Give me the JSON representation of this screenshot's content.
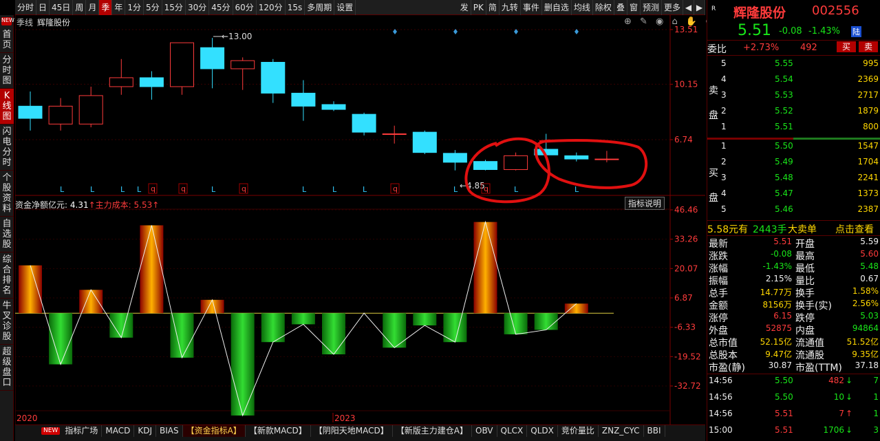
{
  "toolbar": {
    "items": [
      "分时",
      "日",
      "45日",
      "周",
      "月",
      "季",
      "年",
      "1分",
      "5分",
      "15分",
      "30分",
      "45分",
      "60分",
      "120分",
      "15s",
      "多周期",
      "设置"
    ],
    "active_index": 5,
    "right_items": [
      "发",
      "PK",
      "简",
      "九转",
      "事件",
      "删自选",
      "均线",
      "除权",
      "叠",
      "窗",
      "预测",
      "更多"
    ]
  },
  "leftnav": {
    "items": [
      "首页",
      "分时图",
      "K线图",
      "闪电分时",
      "个股资料",
      "自选股",
      "综合排名",
      "牛叉诊股",
      "超级盘口"
    ],
    "active_index": 2,
    "new_badge": "NEW"
  },
  "main_chart": {
    "period_label": "季线",
    "stock_name": "辉隆股份",
    "price_axis": [
      "13.51",
      "10.15",
      "6.74"
    ],
    "high_tag": "13.00",
    "low_tag": "4.85",
    "signals": [
      "L",
      "L",
      "L",
      "L",
      "q",
      "q",
      "L",
      "q",
      "L",
      "L",
      "L",
      "q",
      "L",
      "q",
      "L",
      "L"
    ],
    "candles": [
      {
        "o": 8.8,
        "c": 8.05,
        "h": 9.7,
        "l": 7.3
      },
      {
        "o": 7.7,
        "c": 8.8,
        "h": 9.3,
        "l": 7.3
      },
      {
        "o": 7.7,
        "c": 9.45,
        "h": 10.0,
        "l": 7.5
      },
      {
        "o": 10.0,
        "c": 10.55,
        "h": 11.7,
        "l": 9.5
      },
      {
        "o": 10.55,
        "c": 10.0,
        "h": 10.95,
        "l": 9.2
      },
      {
        "o": 10.0,
        "c": 12.7,
        "h": 12.7,
        "l": 9.5
      },
      {
        "o": 12.4,
        "c": 11.1,
        "h": 13.0,
        "l": 9.9
      },
      {
        "o": 11.1,
        "c": 11.6,
        "h": 11.8,
        "l": 9.8
      },
      {
        "o": 11.5,
        "c": 9.6,
        "h": 11.7,
        "l": 9.0
      },
      {
        "o": 9.6,
        "c": 8.8,
        "h": 10.4,
        "l": 7.9
      },
      {
        "o": 8.9,
        "c": 8.6,
        "h": 9.1,
        "l": 8.5
      },
      {
        "o": 8.3,
        "c": 7.2,
        "h": 8.4,
        "l": 7.0
      },
      {
        "o": 7.1,
        "c": 7.1,
        "h": 7.6,
        "l": 6.5
      },
      {
        "o": 7.2,
        "c": 5.95,
        "h": 7.3,
        "l": 5.85
      },
      {
        "o": 5.9,
        "c": 5.35,
        "h": 6.1,
        "l": 4.85
      },
      {
        "o": 5.4,
        "c": 4.9,
        "h": 5.5,
        "l": 4.85
      },
      {
        "o": 4.9,
        "c": 5.75,
        "h": 5.95,
        "l": 4.85
      },
      {
        "o": 6.15,
        "c": 5.8,
        "h": 7.1,
        "l": 5.75
      },
      {
        "o": 5.75,
        "c": 5.55,
        "h": 5.95,
        "l": 5.4
      },
      {
        "o": 5.51,
        "c": 5.55,
        "h": 6.05,
        "l": 5.35
      }
    ]
  },
  "indicator": {
    "label": "资金净额亿元",
    "value": "4.31",
    "cost_label": "主力成本",
    "cost_value": "5.53",
    "button": "指标说明",
    "axis": [
      "46.46",
      "33.26",
      "20.07",
      "6.87",
      "-6.33",
      "-19.52",
      "-32.72"
    ],
    "bars": [
      21.5,
      -23.0,
      10.5,
      -11.0,
      39.5,
      -20.0,
      6.0,
      -46.0,
      -13.0,
      -5.0,
      -18.5,
      0.0,
      -15.5,
      -5.5,
      -13.0,
      41.0,
      -9.5,
      -7.5,
      4.3
    ],
    "bars_chart_data": {
      "type": "bar",
      "series": [
        {
          "values": [
            21.5,
            -23.0,
            10.5,
            -11.0,
            39.5,
            -20.0,
            6.0,
            -46.0,
            -13.0,
            -5.0,
            -18.5,
            0.0,
            -15.5,
            -5.5,
            -13.0,
            41.0,
            -9.5,
            -7.5,
            4.3
          ]
        }
      ],
      "ylim": [
        -46.0,
        46.46
      ]
    },
    "year_labels": [
      "2020",
      "2023"
    ]
  },
  "bottom_tabs": {
    "items": [
      "指标广场",
      "MACD",
      "KDJ",
      "BIAS",
      "【资金指标A】",
      "【新款MACD】",
      "【阴阳天地MACD】",
      "【新版主力建仓A】",
      "OBV",
      "QLCX",
      "QLDX",
      "竞价量比",
      "ZNZ_CYC",
      "BBI"
    ],
    "active_index": 4,
    "new_badge": "NEW"
  },
  "quote": {
    "name": "辉隆股份",
    "code": "002556",
    "price": "5.51",
    "change": "-0.08",
    "change_pct": "-1.43%",
    "market_flag": "陆",
    "weibi_label": "委比",
    "weibi": "+2.73%",
    "weicha": "492",
    "buy_btn": "买",
    "sell_btn": "卖",
    "sell_label": "卖盘",
    "buy_label": "买盘",
    "asks": [
      {
        "lvl": "5",
        "price": "5.55",
        "vol": "995"
      },
      {
        "lvl": "4",
        "price": "5.54",
        "vol": "2369"
      },
      {
        "lvl": "3",
        "price": "5.53",
        "vol": "2717"
      },
      {
        "lvl": "2",
        "price": "5.52",
        "vol": "1879"
      },
      {
        "lvl": "1",
        "price": "5.51",
        "vol": "800"
      }
    ],
    "bids": [
      {
        "lvl": "1",
        "price": "5.50",
        "vol": "1547"
      },
      {
        "lvl": "2",
        "price": "5.49",
        "vol": "1704"
      },
      {
        "lvl": "3",
        "price": "5.48",
        "vol": "2241"
      },
      {
        "lvl": "4",
        "price": "5.47",
        "vol": "1373"
      },
      {
        "lvl": "5",
        "price": "5.46",
        "vol": "2387"
      }
    ],
    "big_order": {
      "price": "5.58元有",
      "vol": "2443手",
      "text": "大卖单",
      "link": "点击查看"
    },
    "stats": [
      {
        "k1": "最新",
        "v1": "5.51",
        "c1": "red",
        "k2": "开盘",
        "v2": "5.59",
        "c2": "white"
      },
      {
        "k1": "涨跌",
        "v1": "-0.08",
        "c1": "green",
        "k2": "最高",
        "v2": "5.60",
        "c2": "red"
      },
      {
        "k1": "涨幅",
        "v1": "-1.43%",
        "c1": "green",
        "k2": "最低",
        "v2": "5.48",
        "c2": "green"
      },
      {
        "k1": "振幅",
        "v1": "2.15%",
        "c1": "white",
        "k2": "量比",
        "v2": "0.67",
        "c2": "white"
      },
      {
        "k1": "总手",
        "v1": "14.77万",
        "c1": "yellow",
        "k2": "换手",
        "v2": "1.58%",
        "c2": "yellow"
      },
      {
        "k1": "金额",
        "v1": "8156万",
        "c1": "yellow",
        "k2": "换手(实)",
        "v2": "2.56%",
        "c2": "yellow"
      },
      {
        "k1": "涨停",
        "v1": "6.15",
        "c1": "red",
        "k2": "跌停",
        "v2": "5.03",
        "c2": "green"
      },
      {
        "k1": "外盘",
        "v1": "52875",
        "c1": "red",
        "k2": "内盘",
        "v2": "94864",
        "c2": "green"
      },
      {
        "k1": "总市值",
        "v1": "52.15亿",
        "c1": "yellow",
        "k2": "流通值",
        "v2": "51.52亿",
        "c2": "yellow"
      },
      {
        "k1": "总股本",
        "v1": "9.47亿",
        "c1": "yellow",
        "k2": "流通股",
        "v2": "9.35亿",
        "c2": "yellow"
      },
      {
        "k1": "市盈(静)",
        "v1": "30.87",
        "c1": "white",
        "k2": "市盈(TTM)",
        "v2": "37.18",
        "c2": "white"
      }
    ],
    "ticks": [
      {
        "time": "14:56",
        "price": "5.50",
        "pc": "green",
        "vol": "482",
        "vc": "red",
        "dir": "down",
        "extra": "7"
      },
      {
        "time": "14:56",
        "price": "5.50",
        "pc": "green",
        "vol": "10",
        "vc": "green",
        "dir": "down",
        "extra": "1"
      },
      {
        "time": "14:56",
        "price": "5.51",
        "pc": "red",
        "vol": "7",
        "vc": "red",
        "dir": "up",
        "extra": "1"
      },
      {
        "time": "15:00",
        "price": "5.51",
        "pc": "red",
        "vol": "1706",
        "vc": "green",
        "dir": "down",
        "extra": "3"
      }
    ]
  },
  "colors": {
    "up": "#ff3b3b",
    "down": "#33e0ff",
    "annotation": "#e01010",
    "bar_up": "#e00000",
    "bar_down": "#11b011"
  }
}
